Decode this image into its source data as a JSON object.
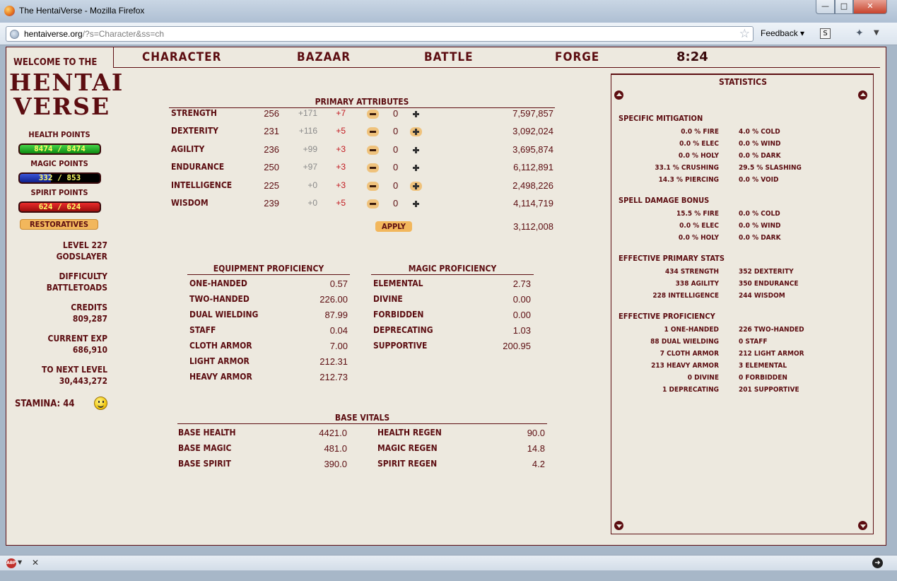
{
  "browser": {
    "title": "The HentaiVerse - Mozilla Firefox",
    "url_host": "hentaiverse.org",
    "url_path": "/?s=Character&ss=ch",
    "feedback": "Feedback",
    "s_label": "S",
    "abp_label": "ABP"
  },
  "logo": {
    "welcome": "Welcome to the",
    "line1": "HENTAI",
    "line2": "VERSE"
  },
  "vitals": {
    "health_label": "Health points",
    "health_value": "8474 / 8474",
    "magic_label": "Magic points",
    "magic_value": "332 / 853",
    "magic_fraction": 0.389,
    "spirit_label": "Spirit points",
    "spirit_value": "624 / 624"
  },
  "restoratives": "Restoratives",
  "info": {
    "level": "Level 227",
    "title": "Godslayer",
    "difficulty_label": "Difficulty",
    "difficulty": "Battletoads",
    "credits_label": "Credits",
    "credits": "809,287",
    "exp_label": "Current EXP",
    "exp": "686,910",
    "next_label": "To Next Level",
    "next": "30,443,272",
    "stamina": "Stamina: 44"
  },
  "nav": {
    "character": "Character",
    "bazaar": "Bazaar",
    "battle": "Battle",
    "forge": "Forge",
    "clock": "8:24"
  },
  "primary": {
    "title": "Primary Attributes",
    "rows": [
      {
        "name": "Strength",
        "base": "256",
        "bonus": "+171",
        "mod": "+7",
        "count": "0",
        "cost": "7,597,857"
      },
      {
        "name": "Dexterity",
        "base": "231",
        "bonus": "+116",
        "mod": "+5",
        "count": "0",
        "cost": "3,092,024"
      },
      {
        "name": "Agility",
        "base": "236",
        "bonus": "+99",
        "mod": "+3",
        "count": "0",
        "cost": "3,695,874"
      },
      {
        "name": "Endurance",
        "base": "250",
        "bonus": "+97",
        "mod": "+3",
        "count": "0",
        "cost": "6,112,891"
      },
      {
        "name": "Intelligence",
        "base": "225",
        "bonus": "+0",
        "mod": "+3",
        "count": "0",
        "cost": "2,498,226"
      },
      {
        "name": "Wisdom",
        "base": "239",
        "bonus": "+0",
        "mod": "+5",
        "count": "0",
        "cost": "4,114,719"
      }
    ],
    "apply": "Apply",
    "total": "3,112,008"
  },
  "equipment": {
    "title": "Equipment Proficiency",
    "rows": [
      {
        "name": "One-handed",
        "value": "0.57"
      },
      {
        "name": "Two-handed",
        "value": "226.00"
      },
      {
        "name": "Dual wielding",
        "value": "87.99"
      },
      {
        "name": "Staff",
        "value": "0.04"
      },
      {
        "name": "Cloth armor",
        "value": "7.00"
      },
      {
        "name": "Light armor",
        "value": "212.31"
      },
      {
        "name": "Heavy armor",
        "value": "212.73"
      }
    ]
  },
  "magic": {
    "title": "Magic Proficiency",
    "rows": [
      {
        "name": "Elemental",
        "value": "2.73"
      },
      {
        "name": "Divine",
        "value": "0.00"
      },
      {
        "name": "Forbidden",
        "value": "0.00"
      },
      {
        "name": "Deprecating",
        "value": "1.03"
      },
      {
        "name": "Supportive",
        "value": "200.95"
      }
    ]
  },
  "base_vitals": {
    "title": "Base Vitals",
    "rows": [
      {
        "name": "Base Health",
        "value": "4421.0",
        "regen_name": "Health Regen",
        "regen": "90.0"
      },
      {
        "name": "Base Magic",
        "value": "481.0",
        "regen_name": "Magic Regen",
        "regen": "14.8"
      },
      {
        "name": "Base Spirit",
        "value": "390.0",
        "regen_name": "Spirit Regen",
        "regen": "4.2"
      }
    ]
  },
  "statistics": {
    "title": "Statistics",
    "sections": [
      {
        "heading": "Specific Mitigation",
        "rows": [
          [
            "0.0 % FIRE",
            "4.0 % COLD"
          ],
          [
            "0.0 % ELEC",
            "0.0 % WIND"
          ],
          [
            "0.0 % HOLY",
            "0.0 % DARK"
          ],
          [
            "33.1 % CRUSHING",
            "29.5 % SLASHING"
          ],
          [
            "14.3 % PIERCING",
            "0.0 % VOID"
          ]
        ]
      },
      {
        "heading": "Spell Damage Bonus",
        "rows": [
          [
            "15.5 % FIRE",
            "0.0 % COLD"
          ],
          [
            "0.0 % ELEC",
            "0.0 % WIND"
          ],
          [
            "0.0 % HOLY",
            "0.0 % DARK"
          ]
        ]
      },
      {
        "heading": "Effective Primary Stats",
        "rows": [
          [
            "434 STRENGTH",
            "352 DEXTERITY"
          ],
          [
            "338 AGILITY",
            "350 ENDURANCE"
          ],
          [
            "228 INTELLIGENCE",
            "244 WISDOM"
          ]
        ]
      },
      {
        "heading": "Effective Proficiency",
        "rows": [
          [
            "1 ONE-HANDED",
            "226 TWO-HANDED"
          ],
          [
            "88 DUAL WIELDING",
            "0 STAFF"
          ],
          [
            "7 CLOTH ARMOR",
            "212 LIGHT ARMOR"
          ],
          [
            "213 HEAVY ARMOR",
            "3 ELEMENTAL"
          ],
          [
            "0 DIVINE",
            "0 FORBIDDEN"
          ],
          [
            "1 DEPRECATING",
            "201 SUPPORTIVE"
          ]
        ]
      }
    ]
  }
}
